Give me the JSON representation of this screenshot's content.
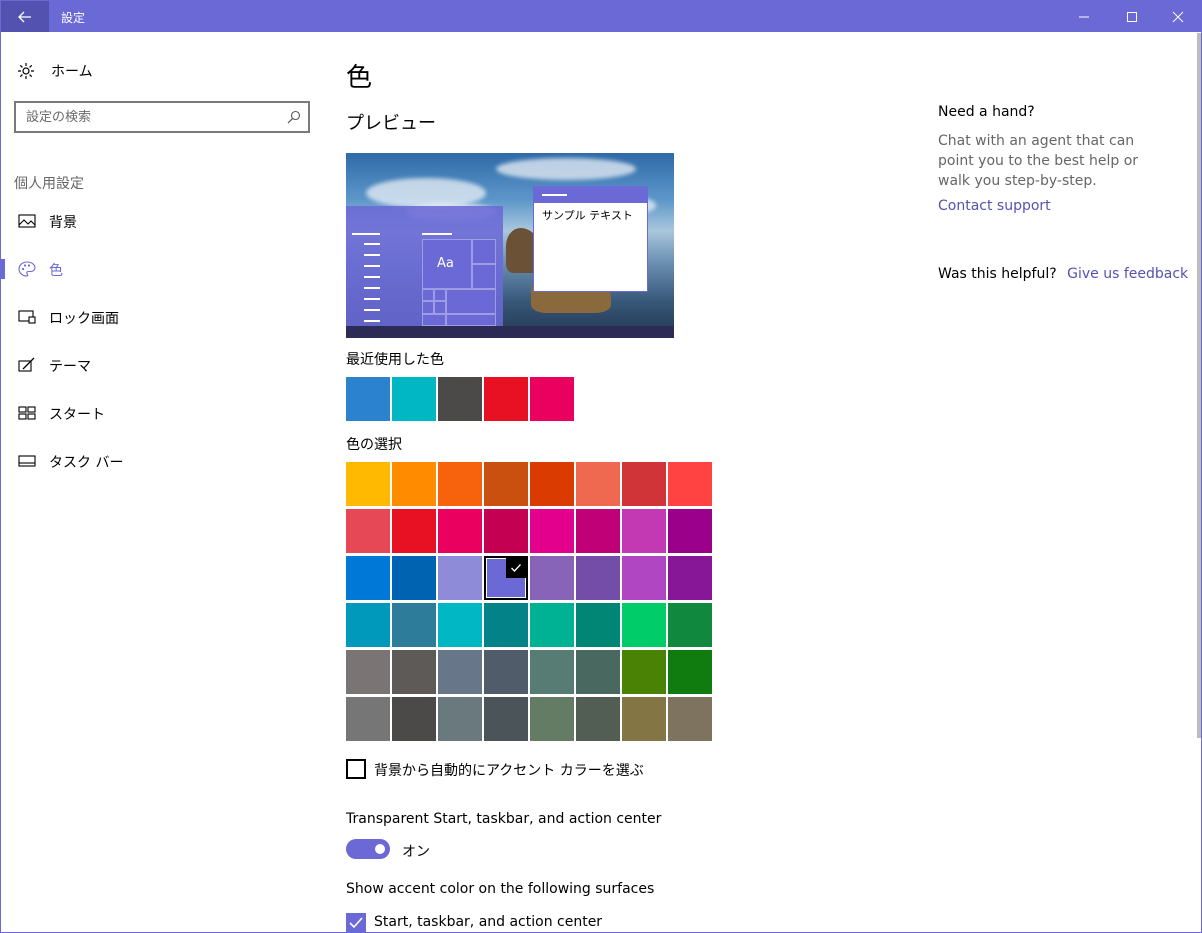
{
  "window": {
    "title": "設定",
    "accent": "#6b69d6"
  },
  "sidebar": {
    "home_label": "ホーム",
    "search_placeholder": "設定の検索",
    "section_title": "個人用設定",
    "items": [
      {
        "label": "背景",
        "icon": "picture-icon",
        "active": false
      },
      {
        "label": "色",
        "icon": "palette-icon",
        "active": true
      },
      {
        "label": "ロック画面",
        "icon": "lock-screen-icon",
        "active": false
      },
      {
        "label": "テーマ",
        "icon": "theme-icon",
        "active": false
      },
      {
        "label": "スタート",
        "icon": "start-icon",
        "active": false
      },
      {
        "label": "タスク バー",
        "icon": "taskbar-icon",
        "active": false
      }
    ]
  },
  "main": {
    "title": "色",
    "preview_title": "プレビュー",
    "preview_sample_text": "サンプル テキスト",
    "preview_tile_text": "Aa",
    "recent_colors_label": "最近使用した色",
    "recent_colors": [
      "#2b83d0",
      "#00b7c3",
      "#4c4a48",
      "#e81123",
      "#ea005e"
    ],
    "choose_color_label": "色の選択",
    "selected_color": "#6b69d6",
    "color_grid": [
      [
        "#ffb900",
        "#ff8c00",
        "#f7630c",
        "#ca5010",
        "#da3b01",
        "#ef6950",
        "#d13438",
        "#ff4343"
      ],
      [
        "#e74856",
        "#e81123",
        "#ea005e",
        "#c30052",
        "#e3008c",
        "#bf0077",
        "#c239b3",
        "#9a0089"
      ],
      [
        "#0078d7",
        "#0063b1",
        "#8e8cd8",
        "#6b69d6",
        "#8764b8",
        "#744da9",
        "#b146c2",
        "#881798"
      ],
      [
        "#0099bc",
        "#2d7d9a",
        "#00b7c3",
        "#038387",
        "#00b294",
        "#018574",
        "#00cc6a",
        "#10893e"
      ],
      [
        "#7a7574",
        "#5d5a58",
        "#68768a",
        "#515c6b",
        "#567c73",
        "#486860",
        "#498205",
        "#107c10"
      ],
      [
        "#767676",
        "#4c4a48",
        "#69797e",
        "#4a5459",
        "#647c64",
        "#525e54",
        "#847545",
        "#7e735f"
      ]
    ],
    "auto_accent_label": "背景から自動的にアクセント カラーを選ぶ",
    "auto_accent_checked": false,
    "transparency_label": "Transparent Start, taskbar, and action center",
    "transparency_state": "オン",
    "transparency_on": true,
    "surfaces_label": "Show accent color on the following surfaces",
    "surface_start_label": "Start, taskbar, and action center",
    "surface_start_checked": true
  },
  "help": {
    "title": "Need a hand?",
    "text": "Chat with an agent that can point you to the best help or walk you step-by-step.",
    "contact_link": "Contact support",
    "helpful_question": "Was this helpful?",
    "feedback_link": "Give us feedback"
  }
}
